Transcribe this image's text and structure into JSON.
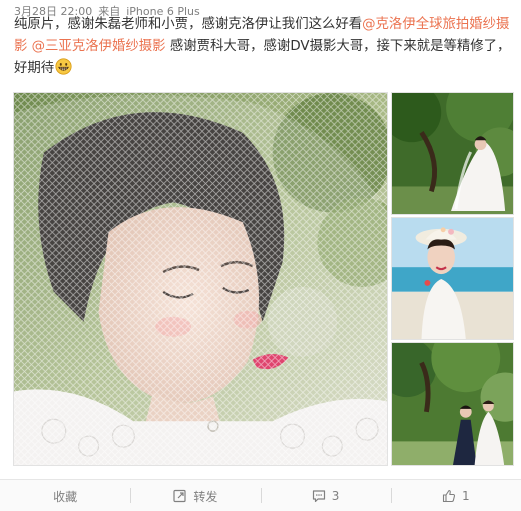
{
  "post": {
    "time": "3月28日 22:00",
    "source_prefix": "来自",
    "source": "iPhone 6 Plus",
    "text_part1": "纯原片，感谢朱磊老师和小贾，感谢克洛伊让我们这么好看",
    "mention1": "@克洛伊全球旅拍婚纱摄影",
    "mention2": "@三亚克洛伊婚纱摄影",
    "text_part2": "感谢贾科大哥，感谢DV摄影大哥，接下来就是等精修了，好期待"
  },
  "emoji": {
    "icon": "grinning-face-emoji"
  },
  "photos": [
    {
      "name": "bride-veil-closeup"
    },
    {
      "name": "bride-under-tree"
    },
    {
      "name": "bride-beach-hat"
    },
    {
      "name": "couple-garden"
    }
  ],
  "actions": {
    "collect_label": "收藏",
    "forward_label": "转发",
    "comment_count": "3",
    "like_count": "1"
  },
  "colors": {
    "mention": "#eb7350",
    "meta": "#808080",
    "text": "#333333"
  }
}
